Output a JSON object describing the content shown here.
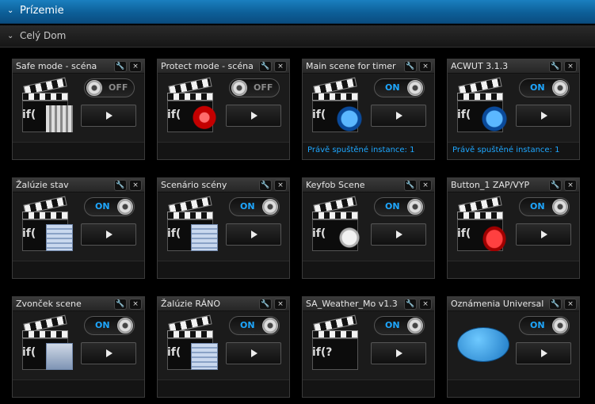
{
  "header": {
    "section_title": "Prízemie",
    "group_title": "Celý Dom"
  },
  "colors": {
    "accent": "#1ea7ff",
    "header_blue": "#0d5f98"
  },
  "cards": [
    {
      "name": "Safe mode - scéna",
      "toggle": "OFF",
      "status": "",
      "icon": "clapperboard-with-bars-icon"
    },
    {
      "name": "Protect mode - scéna",
      "toggle": "OFF",
      "status": "",
      "icon": "clapperboard-with-siren-icon"
    },
    {
      "name": "Main scene for timer",
      "toggle": "ON",
      "status": "Právě spuštěné instance: 1",
      "icon": "clapperboard-with-timer-icon"
    },
    {
      "name": "ACWUT 3.1.3",
      "toggle": "ON",
      "status": "Právě spuštěné instance: 1",
      "icon": "clapperboard-with-timer-icon"
    },
    {
      "name": "Žalúzie stav",
      "toggle": "ON",
      "status": "",
      "icon": "clapperboard-with-blinds-icon"
    },
    {
      "name": "Scenário scény",
      "toggle": "ON",
      "status": "",
      "icon": "clapperboard-with-keypad-icon"
    },
    {
      "name": "Keyfob Scene",
      "toggle": "ON",
      "status": "",
      "icon": "clapperboard-with-keyfob-icon"
    },
    {
      "name": "Button_1 ZAP/VYP",
      "toggle": "ON",
      "status": "",
      "icon": "clapperboard-with-red-button-icon"
    },
    {
      "name": "Zvonček scene",
      "toggle": "ON",
      "status": "",
      "icon": "clapperboard-with-doorbell-icon"
    },
    {
      "name": "Žalúzie RÁNO",
      "toggle": "ON",
      "status": "",
      "icon": "clapperboard-with-blinds-icon"
    },
    {
      "name": "SA_Weather_Mo v1.3",
      "toggle": "ON",
      "status": "",
      "icon": "clapperboard-icon"
    },
    {
      "name": "Oznámenia Universal",
      "toggle": "ON",
      "status": "",
      "icon": "notification-bubble-icon"
    }
  ],
  "icon_glyph": "if("
}
